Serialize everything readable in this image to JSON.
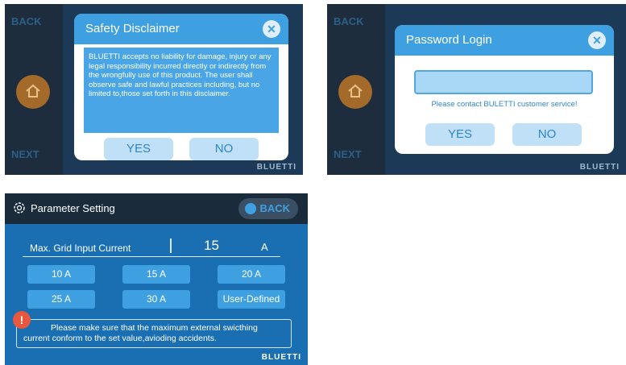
{
  "screen1": {
    "bg": {
      "back": "BACK",
      "next": "NEXT",
      "brand": "BLUETTI",
      "home_icon": "home-icon"
    },
    "dialog": {
      "title": "Safety Disclaimer",
      "close_icon": "close-icon",
      "body": "BLUETTI accepts no liability for damage, injury or any legal responsibility incurred directly or indirectly from the wrongfully use of this product. The user shall observe safe and lawful practices including, but no limited to,those set forth in this disclaimer.",
      "yes": "YES",
      "no": "NO"
    }
  },
  "screen2": {
    "bg": {
      "back": "BACK",
      "next": "NEXT",
      "brand": "BLUETTI",
      "home_icon": "home-icon"
    },
    "dialog": {
      "title": "Password Login",
      "close_icon": "close-icon",
      "password_value": "",
      "hint": "Please contact BULETTI customer service!",
      "yes": "YES",
      "no": "NO"
    }
  },
  "screen3": {
    "title": "Parameter Setting",
    "gear_icon": "gear-icon",
    "back": "BACK",
    "row_label": "Max. Grid Input Current",
    "current_value": "15",
    "unit": "A",
    "options": [
      "10 A",
      "15 A",
      "20 A",
      "25 A",
      "30 A",
      "User-Defined"
    ],
    "warning_line1": "Please make sure that the maximum external swicthing",
    "warning_line2": "current conform to the set value,avioding accidents.",
    "warning_icon": "!",
    "brand": "BLUETTI"
  },
  "colors": {
    "accent": "#3ea0e0",
    "dark_bg": "#16222f",
    "panel_bg": "#1a6fb3",
    "warning": "#e9573f"
  }
}
